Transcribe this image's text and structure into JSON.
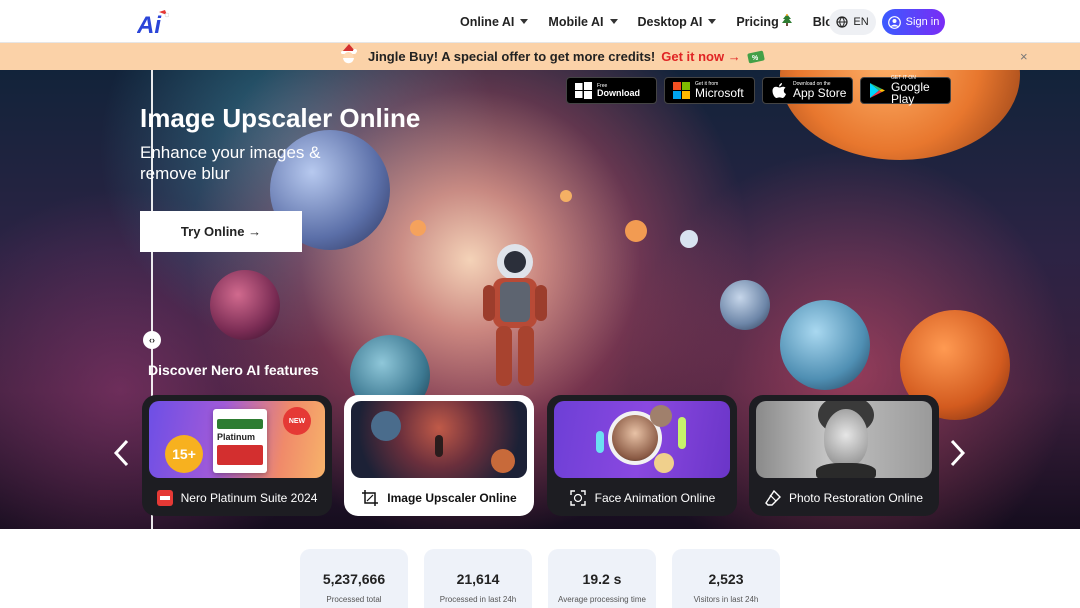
{
  "nav": {
    "logo_text": "Ai",
    "links": [
      {
        "label": "Online AI",
        "has_caret": true
      },
      {
        "label": "Mobile AI",
        "has_caret": true
      },
      {
        "label": "Desktop AI",
        "has_caret": true
      },
      {
        "label": "Pricing",
        "has_caret": false,
        "icon": "tree-icon"
      },
      {
        "label": "Blog",
        "has_caret": false
      }
    ],
    "language": "EN",
    "signin_label": "Sign in",
    "accent_gradient": [
      "#3b5bff",
      "#7a2cf5"
    ]
  },
  "promo": {
    "text": "Jingle Buy! A special offer to get more credits!",
    "link": "Get it now →",
    "close": "×",
    "background": "#fbd2a8",
    "link_color": "#e02424"
  },
  "hero": {
    "title": "Image Upscaler Online",
    "subtitle": "Enhance your images & remove blur",
    "cta_label": "Try Online →",
    "compare_handle": "‹›",
    "stores": [
      {
        "small": "Free",
        "big": "Download",
        "icon": "windows-icon"
      },
      {
        "small": "Get it from",
        "big": "Microsoft",
        "icon": "microsoft-icon"
      },
      {
        "small": "Download on the",
        "big": "App Store",
        "icon": "apple-icon"
      },
      {
        "small": "GET IT ON",
        "big": "Google Play",
        "icon": "google-play-icon"
      }
    ]
  },
  "features": {
    "title": "Discover Nero AI features",
    "prev": "‹",
    "next": "›",
    "cards": [
      {
        "label": "Nero Platinum Suite 2024",
        "badge_count": "15+",
        "badge_new": "NEW",
        "product": "Platinum",
        "icon": "nero-logo-icon",
        "active": false
      },
      {
        "label": "Image Upscaler Online",
        "icon": "crop-icon",
        "active": true
      },
      {
        "label": "Face Animation Online",
        "icon": "face-icon",
        "active": false
      },
      {
        "label": "Photo Restoration Online",
        "icon": "eraser-icon",
        "active": false
      }
    ]
  },
  "stats": [
    {
      "value": "5,237,666",
      "label": "Processed total"
    },
    {
      "value": "21,614",
      "label": "Processed in last 24h"
    },
    {
      "value": "19.2 s",
      "label": "Average processing time"
    },
    {
      "value": "2,523",
      "label": "Visitors in last 24h"
    }
  ]
}
